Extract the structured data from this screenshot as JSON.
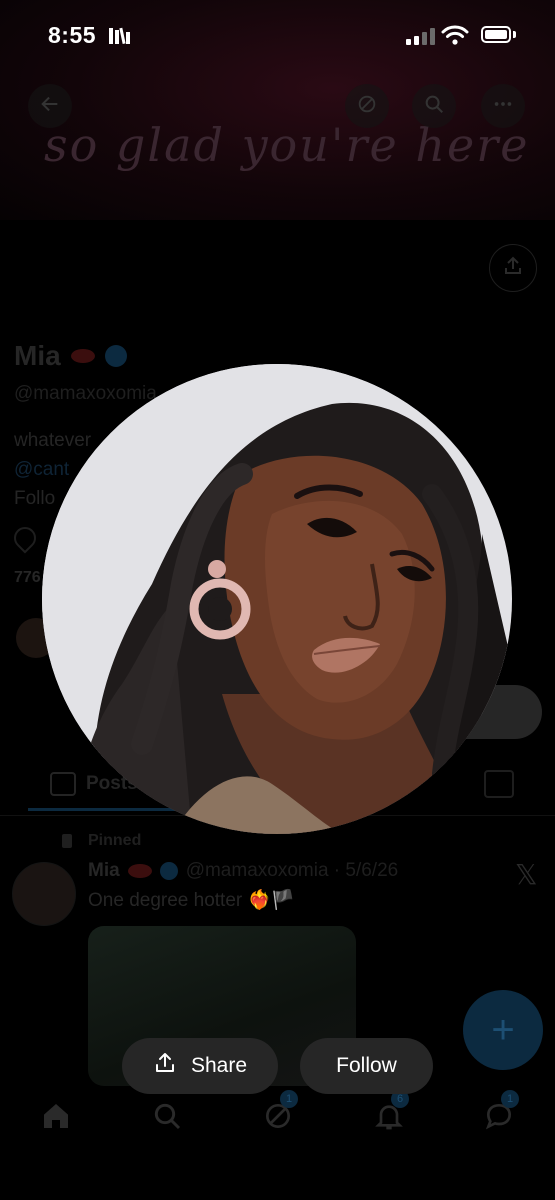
{
  "status_bar": {
    "time": "8:55"
  },
  "banner": {
    "neon_text": "so glad you're here"
  },
  "profile": {
    "name": "Mia",
    "handle": "@mamaxoxomia",
    "bio_line1": "whatever",
    "bio_line2": "@cant",
    "bio_line3": "Follo",
    "following_count_partial": "776"
  },
  "tabs": {
    "posts_label": "Posts"
  },
  "pinned_post": {
    "pinned_label": "Pinned",
    "author_name": "Mia",
    "author_handle_date": "@mamaxoxomia · 5/6/26",
    "text": "One degree hotter ❤️‍🔥🏴",
    "x_glyph": "𝕏"
  },
  "fab": {
    "label": "+"
  },
  "bottom_nav": {
    "grok_badge": "1",
    "notifications_badge": "6",
    "messages_badge": "1"
  },
  "actions": {
    "share_label": "Share",
    "follow_label": "Follow"
  },
  "icons": {
    "back": "arrow-left-icon",
    "grok": "grok-icon",
    "search": "search-icon",
    "more": "more-icon",
    "share": "share-icon",
    "home": "home-icon",
    "notifications": "bell-icon",
    "messages": "messages-icon"
  }
}
